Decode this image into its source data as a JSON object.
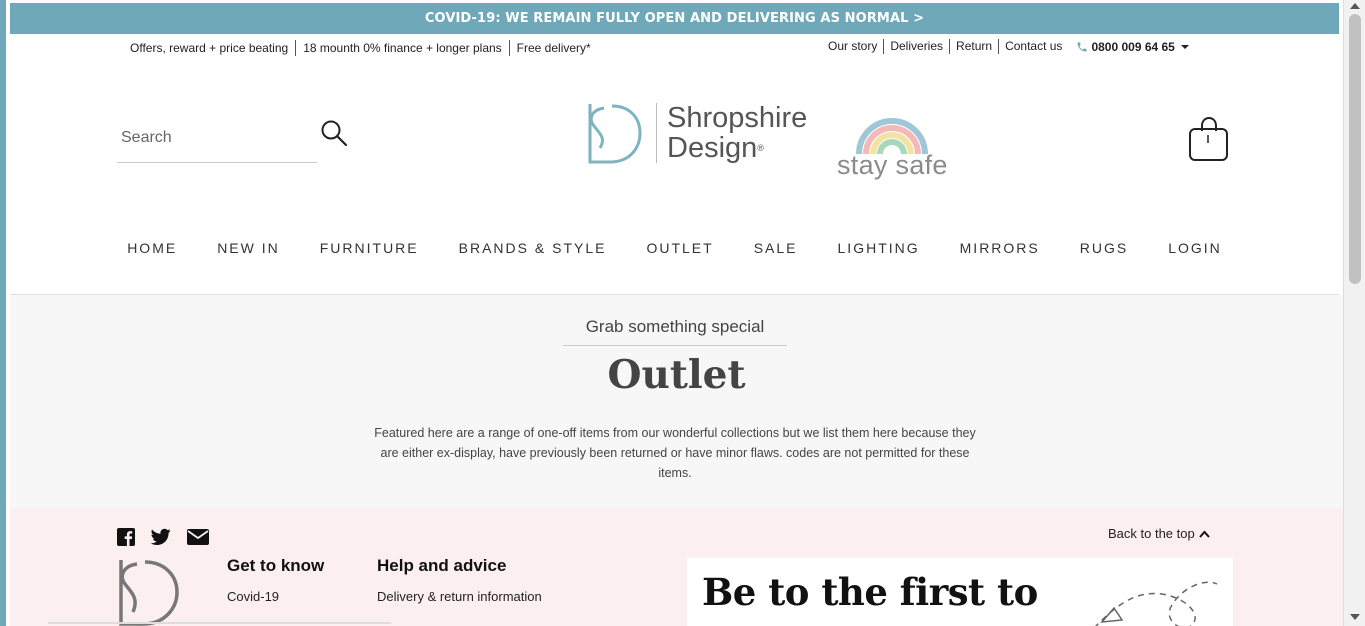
{
  "banner": {
    "text": "COVID-19: WE REMAIN FULLY OPEN AND DELIVERING AS NORMAL >"
  },
  "topbar": {
    "left_items": [
      "Offers, reward + price beating",
      "18 mounth 0% finance + longer plans",
      "Free delivery*"
    ],
    "right_links": [
      "Our story",
      "Deliveries",
      "Return",
      "Contact us"
    ],
    "phone": "0800 009 64 65"
  },
  "search": {
    "placeholder": "Search"
  },
  "logo": {
    "line1": "Shropshire",
    "line2": "Design",
    "reg": "®"
  },
  "staysafe": {
    "text": "stay safe"
  },
  "nav": {
    "items": [
      "HOME",
      "NEW IN",
      "FURNITURE",
      "BRANDS & STYLE",
      "OUTLET",
      "SALE",
      "LIGHTING",
      "MIRRORS",
      "RUGS",
      "LOGIN"
    ]
  },
  "hero": {
    "eyebrow": "Grab something special",
    "title": "Outlet",
    "description": "Featured here are a range of one-off items from our wonderful collections but we list them here because they are either ex-display, have previously been returned or have minor flaws. codes are not permitted for these items."
  },
  "footer": {
    "back_to_top": "Back to the top",
    "columns": [
      {
        "title": "Get to know",
        "first_link": "Covid-19"
      },
      {
        "title": "Help and advice",
        "first_link": "Delivery & return information"
      }
    ],
    "newsletter_heading": "Be to the first to"
  },
  "colors": {
    "accent": "#6fa9b9",
    "footer_bg": "#fbf0ef",
    "hero_bg": "#f7f7f7"
  },
  "icons": [
    "search-icon",
    "phone-icon",
    "bag-icon",
    "facebook-icon",
    "twitter-icon",
    "email-icon",
    "chevron-up-icon",
    "caret-down-icon"
  ]
}
